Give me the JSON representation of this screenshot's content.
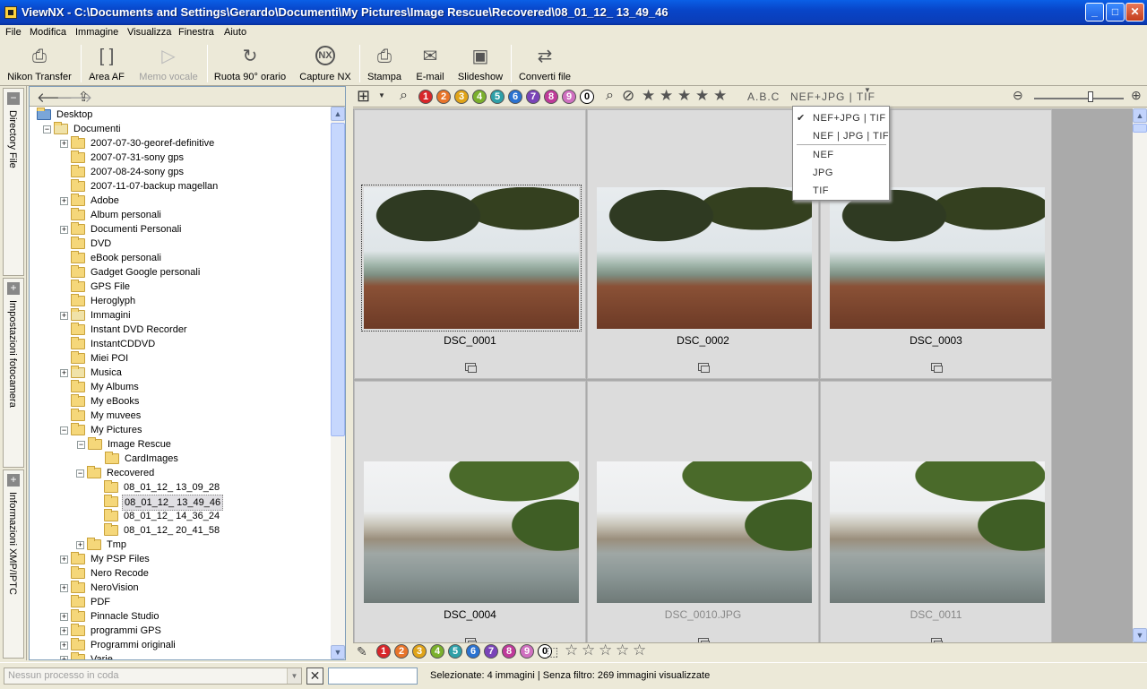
{
  "window": {
    "title": "ViewNX - C:\\Documents and Settings\\Gerardo\\Documenti\\My Pictures\\Image Rescue\\Recovered\\08_01_12_ 13_49_46",
    "minimize": "_",
    "maximize": "□",
    "close": "✕"
  },
  "menu": [
    "File",
    "Modifica",
    "Immagine",
    "Visualizza",
    "Finestra",
    "Aiuto"
  ],
  "toolbar": {
    "items": [
      {
        "label": "Nikon Transfer",
        "icon": "camera-icon",
        "glyph": "⎙",
        "enabled": true
      },
      {
        "label": "Area AF",
        "icon": "af-area-icon",
        "glyph": "[ ]",
        "enabled": true
      },
      {
        "label": "Memo vocale",
        "icon": "voice-memo-icon",
        "glyph": "▷",
        "enabled": false
      },
      {
        "label": "Ruota 90° orario",
        "icon": "rotate-icon",
        "glyph": "↻",
        "enabled": true
      },
      {
        "label": "Capture NX",
        "icon": "capture-nx-icon",
        "glyph": "NX",
        "enabled": true
      },
      {
        "label": "Stampa",
        "icon": "print-icon",
        "glyph": "⎙",
        "enabled": true
      },
      {
        "label": "E-mail",
        "icon": "email-icon",
        "glyph": "✉",
        "enabled": true
      },
      {
        "label": "Slideshow",
        "icon": "slideshow-icon",
        "glyph": "▣",
        "enabled": true
      },
      {
        "label": "Converti file",
        "icon": "convert-file-icon",
        "glyph": "⇄",
        "enabled": true
      }
    ]
  },
  "side_tabs": [
    {
      "label": "Directory File",
      "toggle": "−"
    },
    {
      "label": "Impostazioni fotocamera",
      "toggle": "+"
    },
    {
      "label": "Informazioni XMP/IPTC",
      "toggle": "+"
    }
  ],
  "tree": {
    "nav": {
      "back": "🡐",
      "forward": "🡒",
      "up": "⇪"
    },
    "items": [
      {
        "label": "Desktop",
        "level": 0,
        "exp": "",
        "type": "desktop"
      },
      {
        "label": "Documenti",
        "level": 1,
        "exp": "−",
        "type": "docs"
      },
      {
        "label": "2007-07-30-georef-definitive",
        "level": 2,
        "exp": "+",
        "type": "folder"
      },
      {
        "label": "2007-07-31-sony gps",
        "level": 2,
        "exp": "",
        "type": "folder"
      },
      {
        "label": "2007-08-24-sony gps",
        "level": 2,
        "exp": "",
        "type": "folder"
      },
      {
        "label": "2007-11-07-backup magellan",
        "level": 2,
        "exp": "",
        "type": "folder"
      },
      {
        "label": "Adobe",
        "level": 2,
        "exp": "+",
        "type": "folder"
      },
      {
        "label": "Album personali",
        "level": 2,
        "exp": "",
        "type": "folder"
      },
      {
        "label": "Documenti Personali",
        "level": 2,
        "exp": "+",
        "type": "folder"
      },
      {
        "label": "DVD",
        "level": 2,
        "exp": "",
        "type": "folder"
      },
      {
        "label": "eBook personali",
        "level": 2,
        "exp": "",
        "type": "folder"
      },
      {
        "label": "Gadget Google personali",
        "level": 2,
        "exp": "",
        "type": "folder"
      },
      {
        "label": "GPS File",
        "level": 2,
        "exp": "",
        "type": "folder"
      },
      {
        "label": "Heroglyph",
        "level": 2,
        "exp": "",
        "type": "folder"
      },
      {
        "label": "Immagini",
        "level": 2,
        "exp": "+",
        "type": "special"
      },
      {
        "label": "Instant DVD Recorder",
        "level": 2,
        "exp": "",
        "type": "folder"
      },
      {
        "label": "InstantCDDVD",
        "level": 2,
        "exp": "",
        "type": "folder"
      },
      {
        "label": "Miei POI",
        "level": 2,
        "exp": "",
        "type": "folder"
      },
      {
        "label": "Musica",
        "level": 2,
        "exp": "+",
        "type": "special"
      },
      {
        "label": "My Albums",
        "level": 2,
        "exp": "",
        "type": "folder"
      },
      {
        "label": "My eBooks",
        "level": 2,
        "exp": "",
        "type": "folder"
      },
      {
        "label": "My muvees",
        "level": 2,
        "exp": "",
        "type": "folder"
      },
      {
        "label": "My Pictures",
        "level": 2,
        "exp": "−",
        "type": "folder"
      },
      {
        "label": "Image Rescue",
        "level": 3,
        "exp": "−",
        "type": "folder"
      },
      {
        "label": "CardImages",
        "level": 4,
        "exp": "",
        "type": "folder"
      },
      {
        "label": "Recovered",
        "level": 4,
        "exp": "−",
        "type": "folder",
        "xoff": -20
      },
      {
        "label": "08_01_12_ 13_09_28",
        "level": 5,
        "exp": "",
        "type": "folder",
        "xoff": -20
      },
      {
        "label": "08_01_12_ 13_49_46",
        "level": 5,
        "exp": "",
        "type": "folder",
        "xoff": -20,
        "selected": true
      },
      {
        "label": "08_01_12_ 14_36_24",
        "level": 5,
        "exp": "",
        "type": "folder",
        "xoff": -20
      },
      {
        "label": "08_01_12_ 20_41_58",
        "level": 5,
        "exp": "",
        "type": "folder",
        "xoff": -20
      },
      {
        "label": "Tmp",
        "level": 4,
        "exp": "+",
        "type": "folder",
        "xoff": -20
      },
      {
        "label": "My PSP Files",
        "level": 2,
        "exp": "+",
        "type": "folder"
      },
      {
        "label": "Nero Recode",
        "level": 2,
        "exp": "",
        "type": "folder"
      },
      {
        "label": "NeroVision",
        "level": 2,
        "exp": "+",
        "type": "folder"
      },
      {
        "label": "PDF",
        "level": 2,
        "exp": "",
        "type": "folder"
      },
      {
        "label": "Pinnacle Studio",
        "level": 2,
        "exp": "+",
        "type": "folder"
      },
      {
        "label": "programmi GPS",
        "level": 2,
        "exp": "+",
        "type": "folder"
      },
      {
        "label": "Programmi originali",
        "level": 2,
        "exp": "+",
        "type": "folder"
      },
      {
        "label": "Varie",
        "level": 2,
        "exp": "+",
        "type": "folder"
      }
    ]
  },
  "filterbar": {
    "view_icon": "⊞",
    "labels": [
      "1",
      "2",
      "3",
      "4",
      "5",
      "6",
      "7",
      "8",
      "9",
      "0"
    ],
    "label_colors": [
      "#d8262a",
      "#e8742a",
      "#e0a418",
      "#7bb02c",
      "#2ea0a8",
      "#2a72d0",
      "#7a44b8",
      "#c03a9a",
      "#d070c0",
      "#ffffff"
    ],
    "rating_stars": [
      "★",
      "★",
      "★",
      "★",
      "★"
    ],
    "sort_label": "A.B.C",
    "format_filter": "NEF+JPG | TIF",
    "no_sign": "⃠",
    "zoom_out": "−",
    "zoom_in": "+"
  },
  "format_dropdown": {
    "items": [
      {
        "label": "NEF+JPG | TIF",
        "checked": true
      },
      {
        "label": "NEF | JPG | TIF",
        "checked": false
      },
      {
        "label": "NEF",
        "checked": false
      },
      {
        "label": "JPG",
        "checked": false
      },
      {
        "label": "TIF",
        "checked": false
      }
    ],
    "check": "✔"
  },
  "thumbnails": [
    {
      "name": "DSC_0001",
      "photo": "tree",
      "selected": true,
      "dim": false
    },
    {
      "name": "DSC_0002",
      "photo": "tree",
      "selected": false,
      "dim": false
    },
    {
      "name": "DSC_0003",
      "photo": "tree",
      "selected": false,
      "dim": false
    },
    {
      "name": "DSC_0004",
      "photo": "sea",
      "selected": false,
      "dim": false
    },
    {
      "name": "DSC_0010.JPG",
      "photo": "sea",
      "selected": false,
      "dim": true
    },
    {
      "name": "DSC_0011",
      "photo": "sea",
      "selected": false,
      "dim": true
    }
  ],
  "bottom_bar": {
    "labels": [
      "1",
      "2",
      "3",
      "4",
      "5",
      "6",
      "7",
      "8",
      "9",
      "0"
    ],
    "stars": [
      "☆",
      "☆",
      "☆",
      "☆",
      "☆"
    ]
  },
  "statusbar": {
    "queue_placeholder": "Nessun processo in coda",
    "cancel": "✕",
    "status_text": "Selezionate: 4 immagini | Senza filtro: 269 immagini visualizzate"
  }
}
